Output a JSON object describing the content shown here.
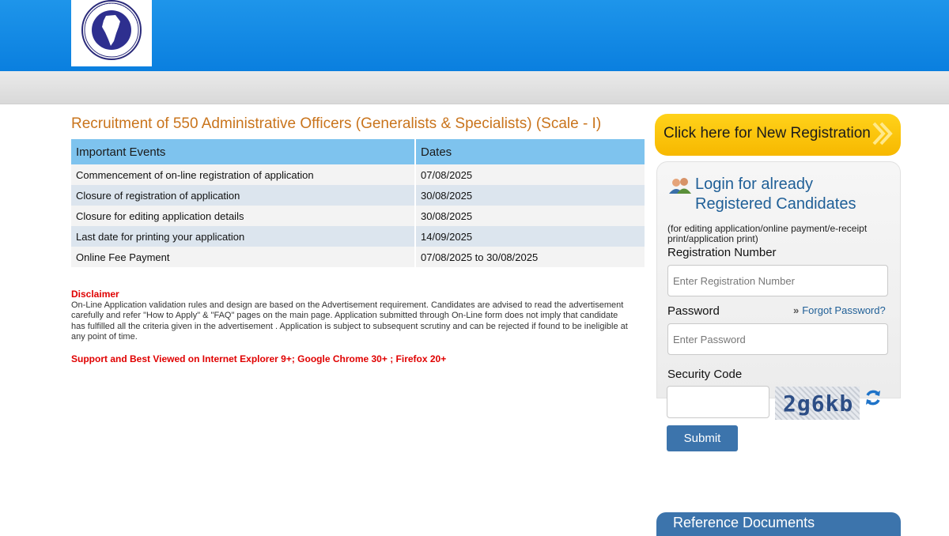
{
  "header": {
    "logo_alt": "THE NEW INDIA ASSURANCE CO. LTD.",
    "colors": {
      "header_blue": "#0a7fdf",
      "title_orange": "#c9741c",
      "table_header": "#7ec3ee"
    }
  },
  "main": {
    "title": "Recruitment of 550 Administrative Officers (Generalists & Specialists) (Scale - I)",
    "table": {
      "headers": [
        "Important Events",
        "Dates"
      ],
      "rows": [
        {
          "event": "Commencement of on-line registration of application",
          "date": "07/08/2025"
        },
        {
          "event": "Closure of registration of application",
          "date": "30/08/2025"
        },
        {
          "event": "Closure for editing application details",
          "date": "30/08/2025"
        },
        {
          "event": "Last date for printing your application",
          "date": "14/09/2025"
        },
        {
          "event": "Online Fee Payment",
          "date": "07/08/2025 to 30/08/2025"
        }
      ]
    },
    "disclaimer_title": "Disclaimer",
    "disclaimer_text": "On-Line Application validation rules and design are based on the Advertisement requirement. Candidates are advised to read the advertisement carefully and refer \"How to Apply\" & \"FAQ\" pages on the main page. Application submitted through On-Line form does not imply that candidate has fulfilled all the criteria given in the advertisement . Application is subject to subsequent scrutiny and can be rejected if found to be ineligible at any point of time.",
    "support_text": "Support and Best Viewed on Internet Explorer 9+; Google Chrome 30+ ; Firefox 20+"
  },
  "sidebar": {
    "new_registration_label": "Click here for New Registration",
    "login": {
      "title": "Login for already Registered Candidates",
      "note": "(for editing application/online payment/e-receipt print/application print)",
      "registration_label": "Registration Number",
      "registration_placeholder": "Enter Registration Number",
      "password_label": "Password",
      "password_placeholder": "Enter Password",
      "forgot_label": "Forgot Password?",
      "security_label": "Security Code",
      "captcha_text": "2g6kb",
      "submit_label": "Submit"
    },
    "reference_docs_label": "Reference Documents"
  }
}
